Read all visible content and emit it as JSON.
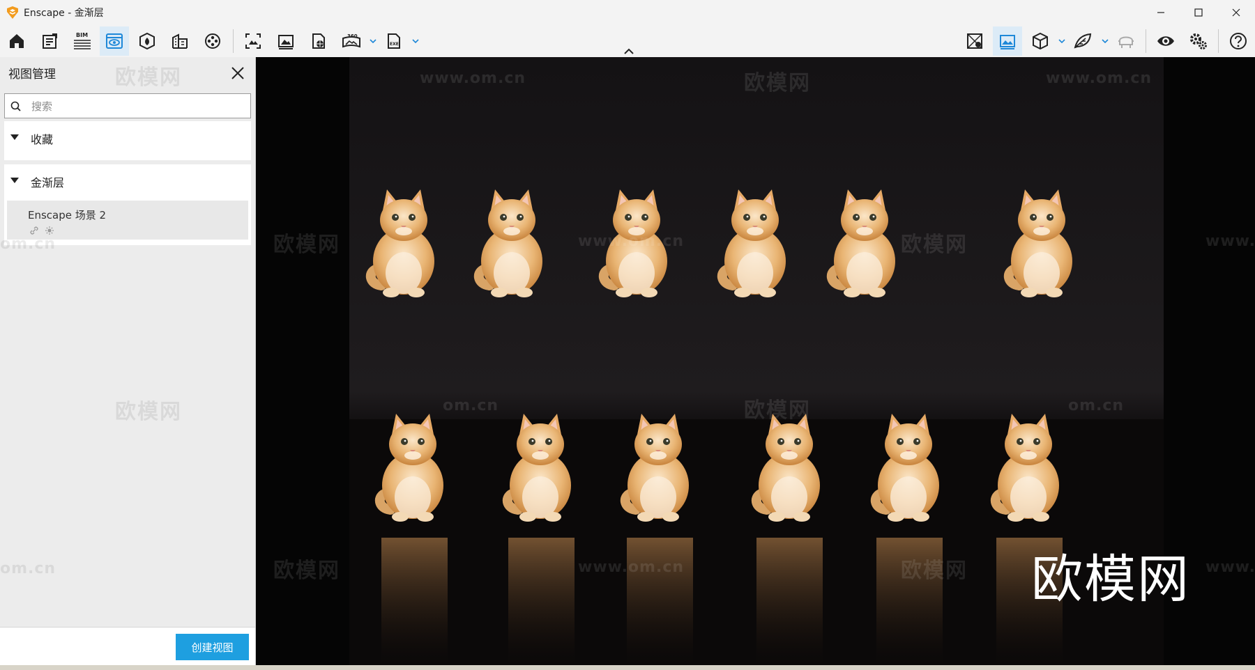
{
  "window": {
    "title": "Enscape - 金渐层",
    "controls": [
      "minimize-icon",
      "maximize-icon",
      "close-icon"
    ]
  },
  "toolbar": {
    "left_tools": [
      {
        "name": "home-icon"
      },
      {
        "name": "notes-icon"
      },
      {
        "name": "bim-icon",
        "label": "BIM"
      },
      {
        "name": "view-management-icon",
        "active": true
      },
      {
        "name": "material-icon"
      },
      {
        "name": "site-context-icon"
      },
      {
        "name": "video-reel-icon"
      },
      {
        "name": "screenshot-icon"
      },
      {
        "name": "batch-render-icon"
      },
      {
        "name": "web-standalone-icon"
      },
      {
        "name": "panorama-360-icon",
        "label": "360"
      },
      {
        "name": "exe-export-icon",
        "label": "EXE"
      }
    ],
    "right_tools": [
      {
        "name": "map-icon"
      },
      {
        "name": "image-settings-icon",
        "active": true
      },
      {
        "name": "asset-cube-icon"
      },
      {
        "name": "sketch-leaf-icon"
      },
      {
        "name": "vr-headset-icon"
      },
      {
        "name": "eye-icon"
      },
      {
        "name": "settings-gears-icon"
      },
      {
        "name": "help-icon"
      }
    ],
    "active_color": "#1e88d8"
  },
  "panel": {
    "title": "视图管理",
    "search_placeholder": "搜索",
    "groups": [
      {
        "label": "收藏",
        "items": []
      },
      {
        "label": "金渐层",
        "items": [
          {
            "name": "Enscape 场景 2"
          }
        ]
      }
    ],
    "create_button": "创建视图",
    "watermark": "欧模网",
    "watermark_url": "om.cn"
  },
  "viewport": {
    "watermarks": {
      "brand": "欧模网",
      "url": "www.om.cn",
      "url_partial": "www.",
      "url_suffix": "om.cn",
      "cn_suffix": "om.cn"
    },
    "big_logo": "欧模网"
  },
  "colors": {
    "accent": "#1e9fe0",
    "background": "#f3f3f3",
    "viewport_bg": "#050505"
  }
}
